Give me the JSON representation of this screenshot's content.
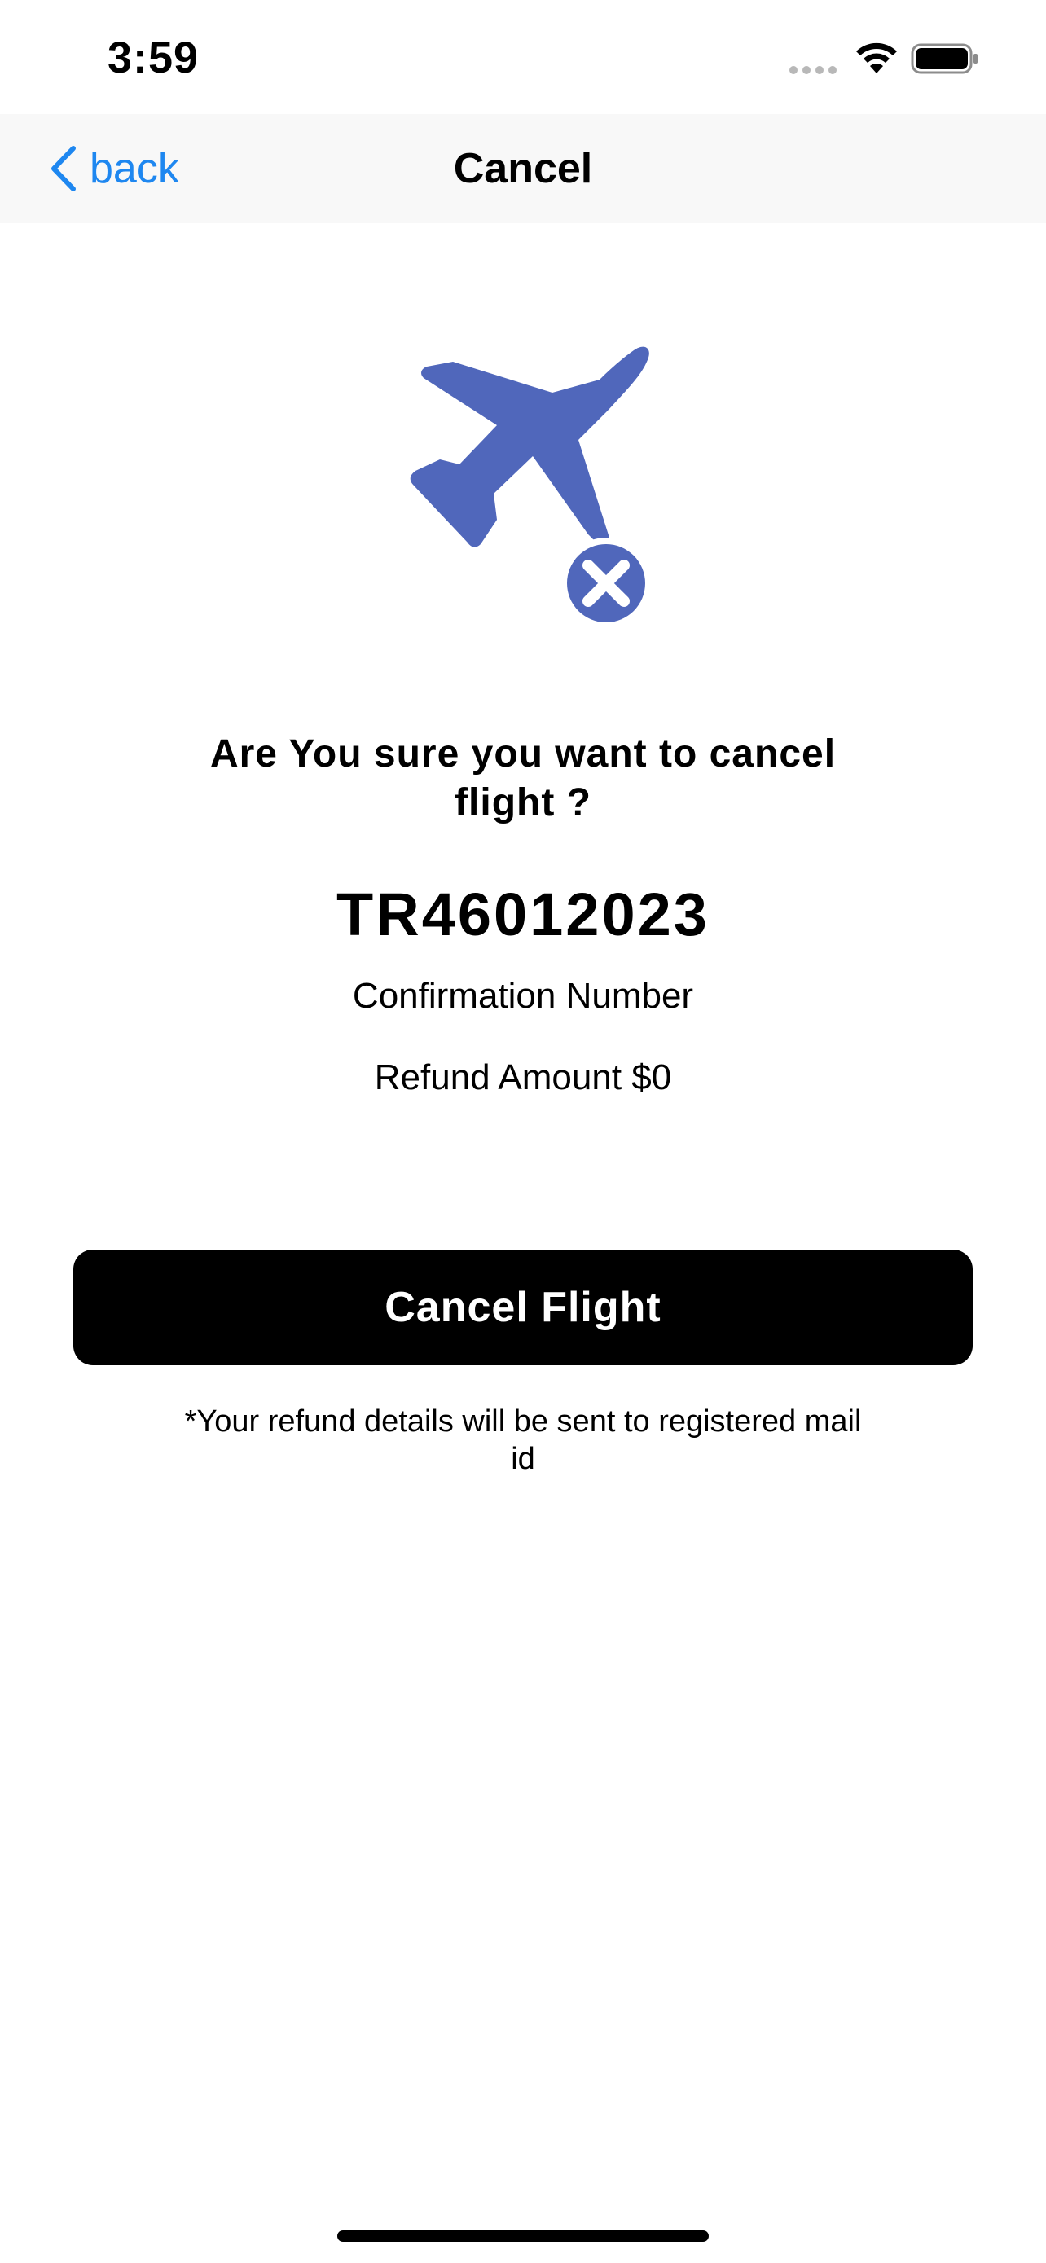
{
  "status_bar": {
    "time": "3:59",
    "icons": [
      "signal-dots-icon",
      "wifi-icon",
      "battery-icon"
    ]
  },
  "nav": {
    "back_label": "back",
    "title": "Cancel",
    "back_icon": "chevron-left-icon"
  },
  "illustration": {
    "icon": "airplane-cancel-icon",
    "color": "#5067bb"
  },
  "content": {
    "question": "Are You sure you want to cancel flight ?",
    "confirmation_number": "TR46012023",
    "confirmation_label": "Confirmation Number",
    "refund_amount": "Refund Amount $0"
  },
  "actions": {
    "cancel_flight_label": "Cancel Flight"
  },
  "footer": {
    "note": "*Your refund details will be sent to registered mail id"
  },
  "colors": {
    "accent": "#1e87f0",
    "button_bg": "#000000",
    "nav_bg": "#f8f8f8"
  }
}
